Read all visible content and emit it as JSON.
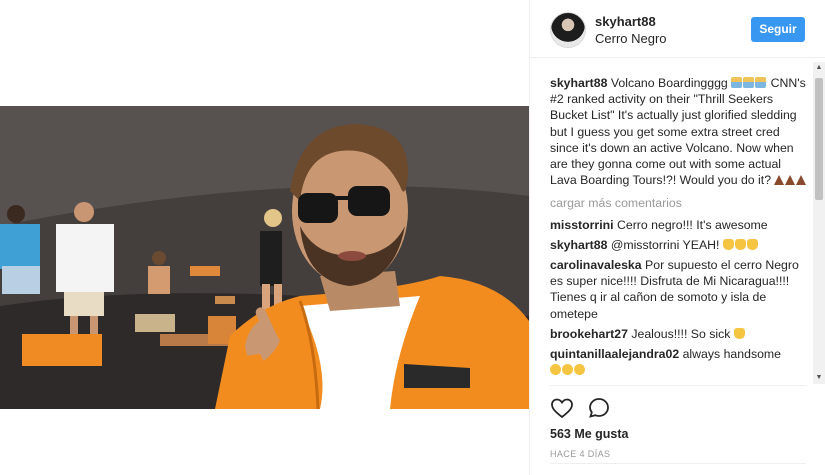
{
  "post": {
    "username": "skyhart88",
    "location": "Cerro Negro",
    "follow_label": "Seguir",
    "caption_user": "skyhart88",
    "caption_text_1": " Volcano Boardingggg ",
    "caption_text_2": " CNN's #2 ranked activity on their \"Thrill Seekers Bucket List\" It's actually just glorified sledding but I guess you get some extra street cred since it's down an active Volcano. Now when are they gonna come out with some actual Lava Boarding Tours!?! Would you do it? ",
    "load_more": "cargar más comentarios",
    "likes": "563 Me gusta",
    "time_ago": "HACE 4 DÍAS"
  },
  "comments": [
    {
      "user": "misstorrini",
      "text": " Cerro negro!!! It's awesome"
    },
    {
      "user": "skyhart88",
      "text": " @misstorrini YEAH! "
    },
    {
      "user": "carolinavaleska",
      "text": " Por supuesto el cerro Negro es super nice!!!! Disfruta de Mi Nicaragua!!!! Tienes q ir al cañon de somoto y isla de ometepe"
    },
    {
      "user": "brookehart27",
      "text": " Jealous!!!! So sick "
    },
    {
      "user": "quintanillaalejandra02",
      "text": " always handsome"
    }
  ],
  "icons": {
    "heart": "heart-outline-icon",
    "comment": "speech-bubble-icon",
    "scroll_up": "triangle-up",
    "scroll_down": "triangle-down"
  },
  "colors": {
    "accent": "#3897f0",
    "jacket": "#f28c1e",
    "muted": "#999999"
  }
}
